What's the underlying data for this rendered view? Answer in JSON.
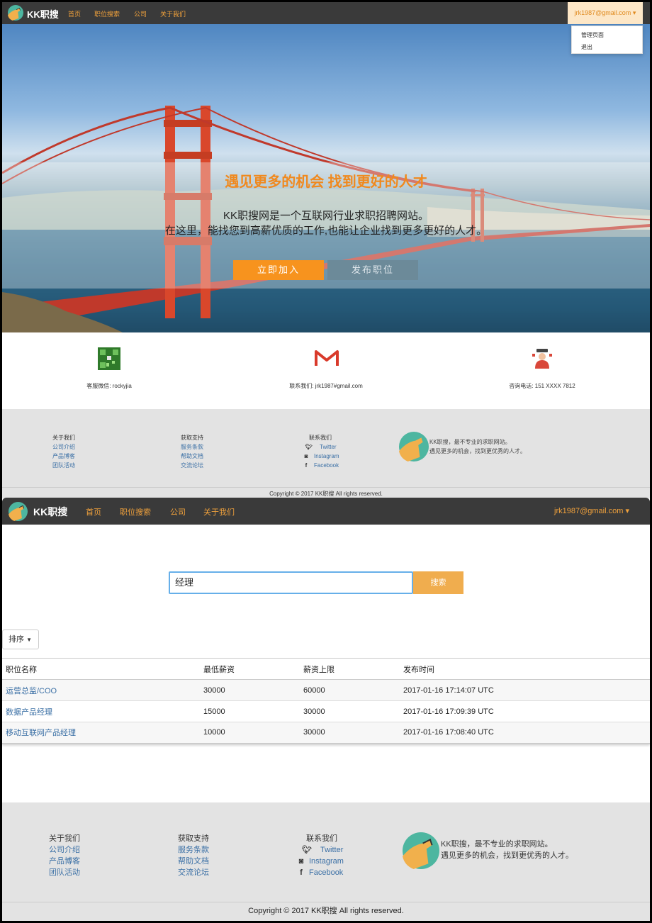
{
  "brand": {
    "name": "KK职搜"
  },
  "nav": {
    "items": [
      "首页",
      "职位搜索",
      "公司",
      "关于我们"
    ],
    "user": "jrk1987@gmail.com"
  },
  "dropdown": {
    "items": [
      "管理页面",
      "退出"
    ]
  },
  "hero": {
    "title": "遇见更多的机会 找到更好的人才",
    "subtitle1": "KK职搜网是一个互联网行业求职招聘网站。",
    "subtitle2": "在这里，能找您到高薪优质的工作,也能让企业找到更多更好的人才。",
    "join_label": "立即加入",
    "post_label": "发布职位"
  },
  "contact": {
    "wechat": "客服微信: rockyjia",
    "email": "联系我们: jrk1987#gmail.com",
    "phone": "咨询电话: 151 XXXX 7812"
  },
  "footer": {
    "about": {
      "heading": "关于我们",
      "links": [
        "公司介绍",
        "产品博客",
        "团队活动"
      ]
    },
    "support": {
      "heading": "获取支持",
      "links": [
        "服务条款",
        "帮助文档",
        "交流论坛"
      ]
    },
    "contact": {
      "heading": "联系我们",
      "links": [
        "Twitter",
        "Instagram",
        "Facebook"
      ]
    },
    "desc1": "KK职搜，最不专业的求职网站。",
    "desc2": "遇见更多的机会，找到更优秀的人才。",
    "copyright": "Copyright © 2017 KK职搜 All rights reserved."
  },
  "search": {
    "value": "经理",
    "button": "搜索"
  },
  "sort": {
    "label": "排序"
  },
  "table": {
    "headers": [
      "职位名称",
      "最低薪资",
      "薪资上限",
      "发布时间"
    ],
    "rows": [
      [
        "运营总监/COO",
        "30000",
        "60000",
        "2017-01-16 17:14:07 UTC"
      ],
      [
        "数据产品经理",
        "15000",
        "30000",
        "2017-01-16 17:09:39 UTC"
      ],
      [
        "移动互联网产品经理",
        "10000",
        "30000",
        "2017-01-16 17:08:40 UTC"
      ]
    ]
  },
  "colors": {
    "accent": "#f7931e",
    "nav_bg": "#3a3a3a",
    "link": "#3a6fa5",
    "footer_bg": "#e3e3e3"
  }
}
